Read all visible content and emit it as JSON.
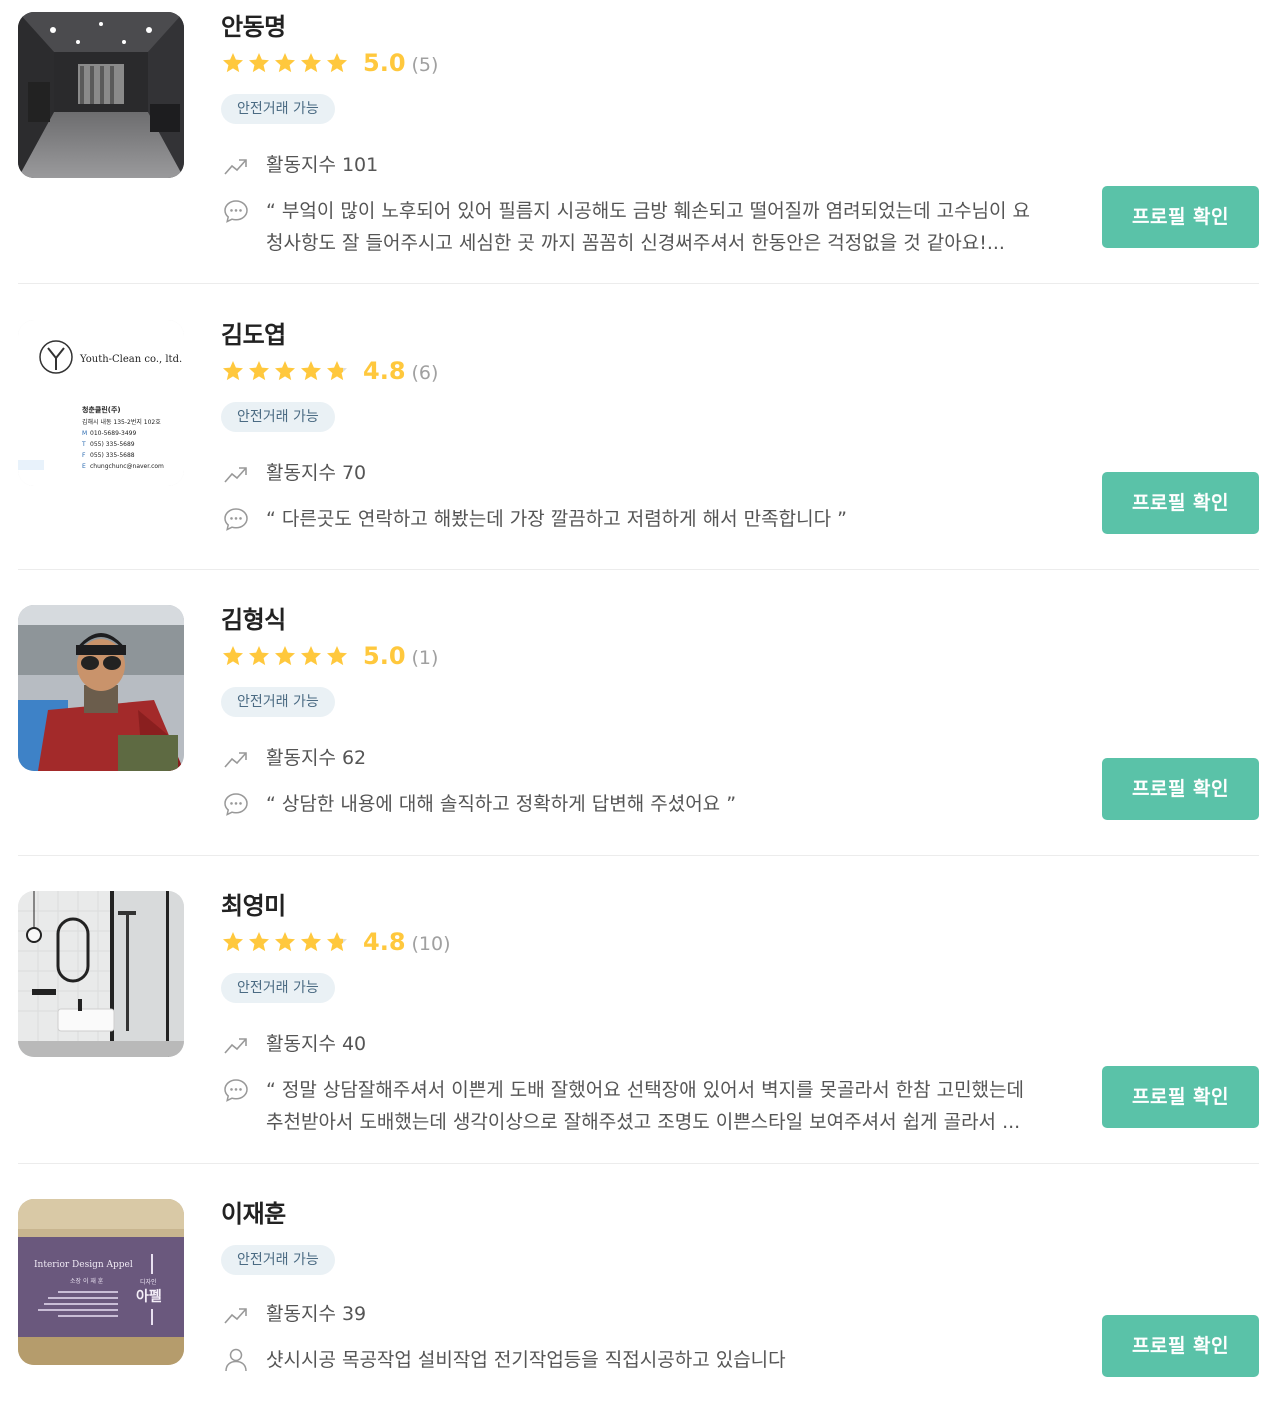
{
  "colors": {
    "star": "#ffc83d",
    "star_empty": "#dcdcdc",
    "button": "#5ac2a8",
    "badge_bg": "#eaf1f5",
    "badge_text": "#4b6b83",
    "separator": "#ececec"
  },
  "experts": [
    {
      "name": "안동명",
      "rating": 5.0,
      "rating_text": "5.0",
      "count_text": "(5)",
      "badge": "안전거래 가능",
      "activity_label": "활동지수 101",
      "comment_icon": "chat-bubble-icon",
      "comment": "“ 부엌이 많이 노후되어 있어 필름지 시공해도 금방 훼손되고 떨어질까 염려되었는데 고수님이 요청사항도 잘 들어주시고 세심한 곳 까지 꼼꼼히 신경써주셔서 한동안은 걱정없을 것 같아요!...",
      "button": "프로필 확인",
      "thumbnail": "dark-room-photo"
    },
    {
      "name": "김도엽",
      "rating": 4.8,
      "rating_text": "4.8",
      "count_text": "(6)",
      "badge": "안전거래 가능",
      "activity_label": "활동지수 70",
      "comment_icon": "chat-bubble-icon",
      "comment": "“ 다른곳도 연락하고 해봤는데 가장 깔끔하고 저렴하게 해서 만족합니다 ”",
      "button": "프로필 확인",
      "thumbnail": "business-card",
      "card": {
        "company": "Youth-Clean co., ltd.",
        "korean_name": "청춘클린(주)",
        "address": "김해시 내동 135-2번지 102호",
        "m_label": "M",
        "mobile": "010-5689-3499",
        "t_label": "T",
        "tel": "055) 335-5689",
        "f_label": "F",
        "fax": "055) 335-5688",
        "e_label": "E",
        "email": "chungchunc@naver.com"
      }
    },
    {
      "name": "김형식",
      "rating": 5.0,
      "rating_text": "5.0",
      "count_text": "(1)",
      "badge": "안전거래 가능",
      "activity_label": "활동지수 62",
      "comment_icon": "chat-bubble-icon",
      "comment": "“ 상담한 내용에 대해 솔직하고 정확하게 답변해 주셨어요 ”",
      "button": "프로필 확인",
      "thumbnail": "person-on-boat-photo"
    },
    {
      "name": "최영미",
      "rating": 4.8,
      "rating_text": "4.8",
      "count_text": "(10)",
      "badge": "안전거래 가능",
      "activity_label": "활동지수 40",
      "comment_icon": "chat-bubble-icon",
      "comment": "“ 정말 상담잘해주셔서 이쁜게 도배 잘했어요 선택장애 있어서 벽지를 못골라서 한참 고민했는데 추천받아서 도배했는데 생각이상으로 잘해주셨고 조명도 이쁜스타일 보여주셔서 쉽게 골라서 ...",
      "button": "프로필 확인",
      "thumbnail": "bathroom-photo"
    },
    {
      "name": "이재훈",
      "badge": "안전거래 가능",
      "activity_label": "활동지수 39",
      "comment_icon": "person-icon",
      "comment": "샷시시공 목공작업 설비작업 전기작업등을 직접시공하고 있습니다",
      "button": "프로필 확인",
      "thumbnail": "business-card-purple",
      "card": {
        "title": "Interior Design Appel",
        "role": "소장 이 재 훈",
        "brand_small": "디자인",
        "brand": "아펠"
      }
    }
  ]
}
